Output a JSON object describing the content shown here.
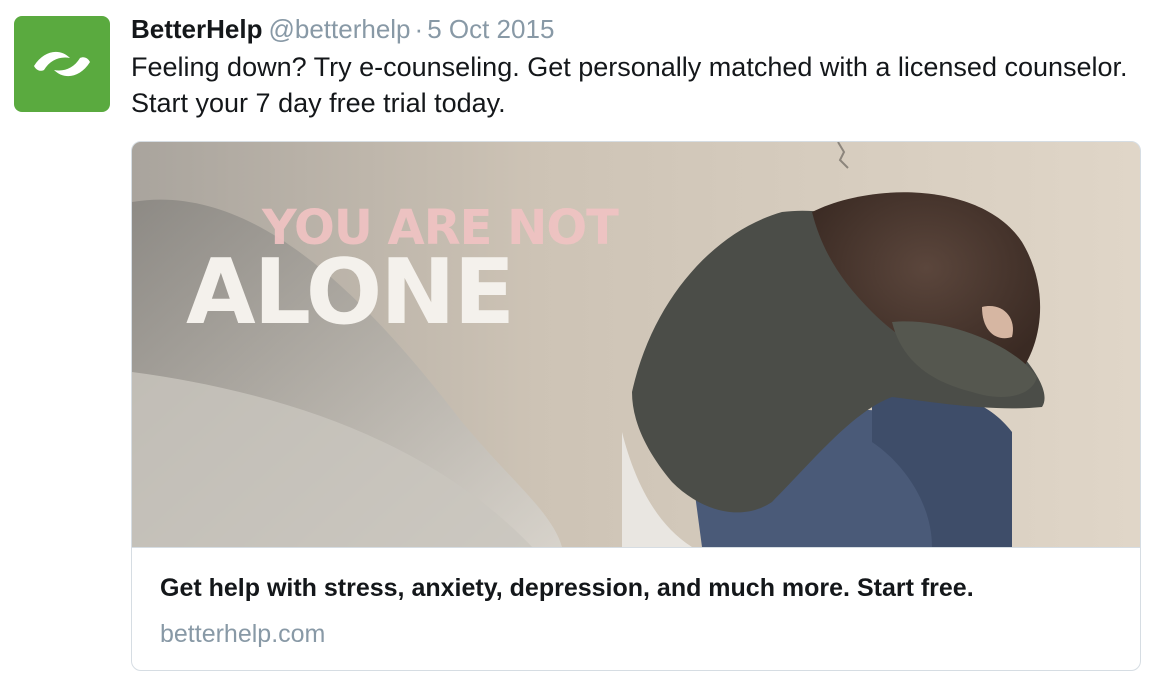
{
  "user": {
    "name": "BetterHelp",
    "handle": "@betterhelp",
    "separator": "·",
    "date": "5 Oct 2015",
    "avatar_icon": "hands-leaf-icon",
    "avatar_color": "#5aaa3f"
  },
  "tweet": {
    "text": "Feeling down? Try e-counseling. Get personally matched with a licensed counselor. Start your 7 day free trial today."
  },
  "card": {
    "image": {
      "headline_top": "YOU ARE NOT",
      "headline_bottom": "ALONE"
    },
    "title": "Get help with stress, anxiety, depression, and much more. Start free.",
    "domain": "betterhelp.com"
  },
  "colors": {
    "text": "#14171a",
    "muted": "#8899a6",
    "border": "#d6dde3",
    "brand_green": "#5aaa3f"
  }
}
